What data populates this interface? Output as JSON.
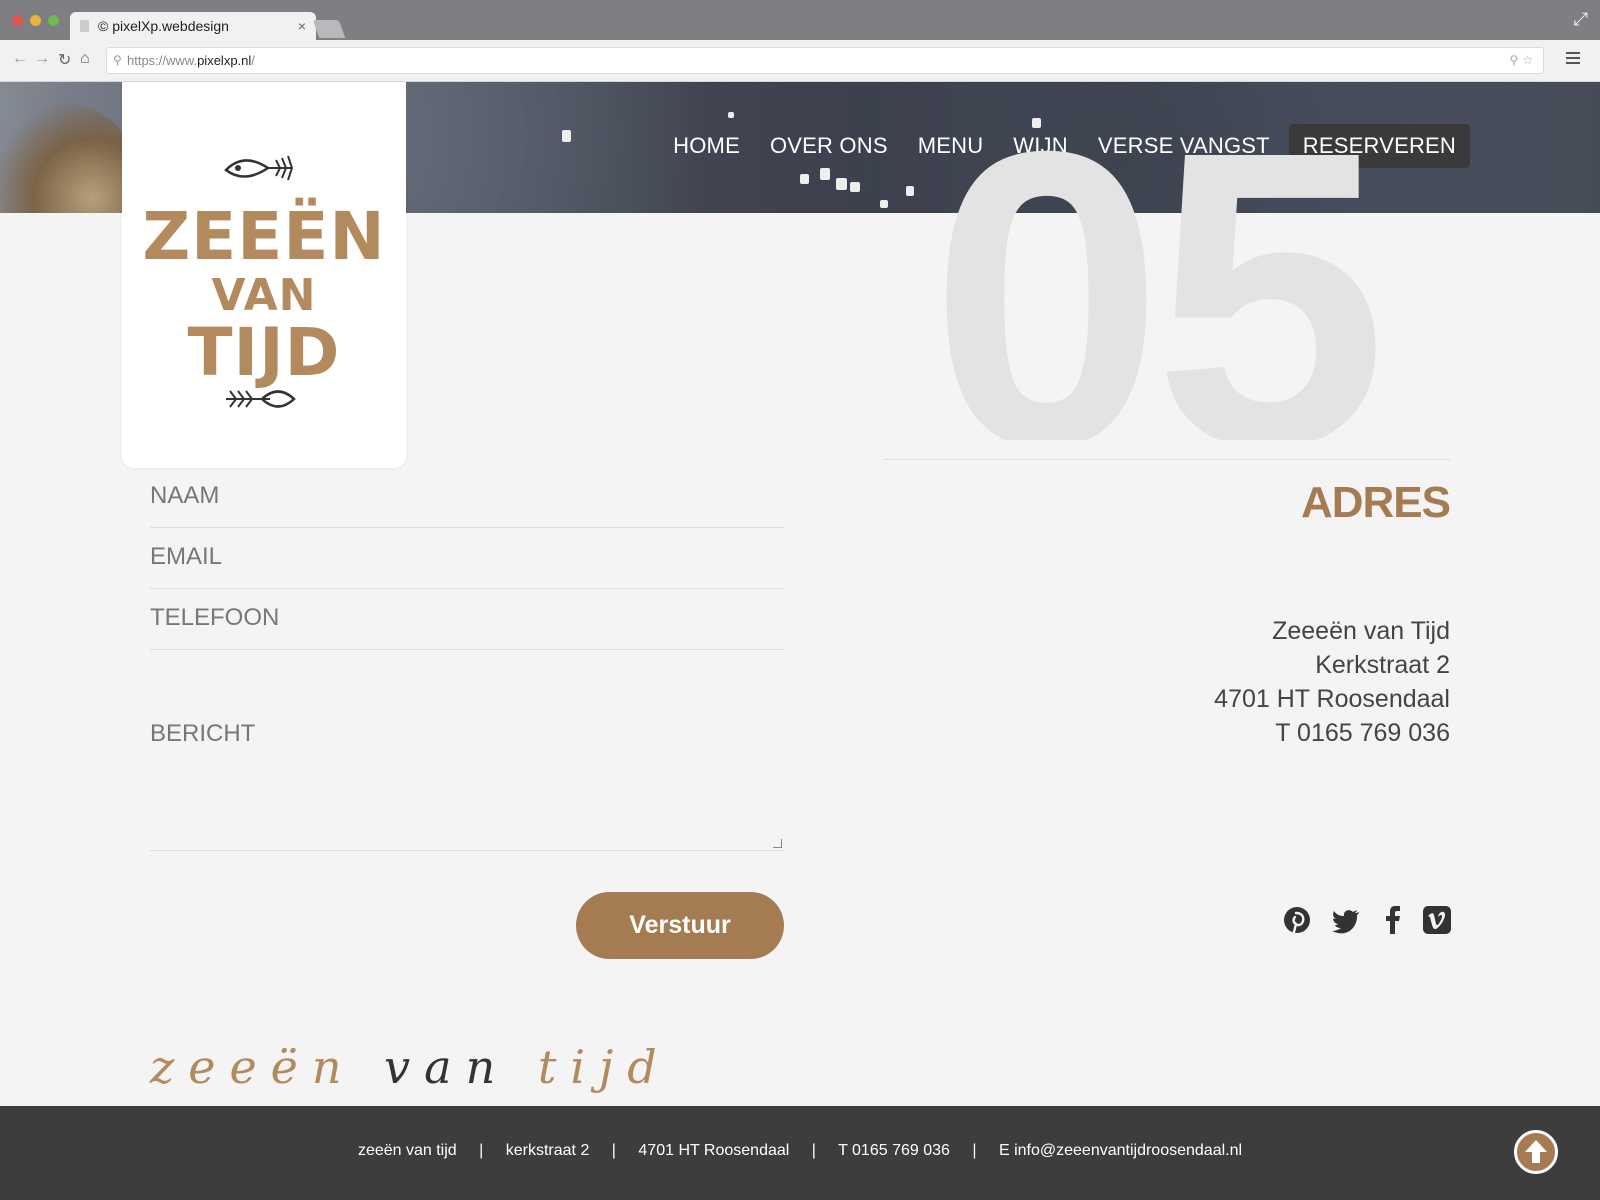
{
  "browser": {
    "tab_title": "© pixelXp.webdesign",
    "tab_close": "×",
    "url_scheme": "https://www.",
    "url_host": "pixelxp.nl",
    "url_path": "/",
    "back": "←",
    "forward": "→",
    "reload": "↻",
    "home": "⌂",
    "expand": "⤢"
  },
  "nav": {
    "items": [
      "HOME",
      "OVER ONS",
      "MENU",
      "WIJN",
      "VERSE VANGST"
    ],
    "cta": "RESERVEREN"
  },
  "logo": {
    "line1": "ZEEËN",
    "line2": "VAN",
    "line3": "TIJD",
    "brand_color": "#b28a5e"
  },
  "section": {
    "number": "05",
    "title": "ADRES"
  },
  "form": {
    "name_placeholder": "NAAM",
    "email_placeholder": "EMAIL",
    "phone_placeholder": "TELEFOON",
    "message_placeholder": "BERICHT",
    "submit_label": "Verstuur"
  },
  "address": {
    "name": "Zeeeën van Tijd",
    "street": "Kerkstraat 2",
    "city": "4701 HT Roosendaal",
    "phone": "T 0165 769 036"
  },
  "social": [
    "pinterest-icon",
    "twitter-icon",
    "facebook-icon",
    "vimeo-icon"
  ],
  "signature": {
    "part1": "zeeën",
    "part2": "van",
    "part3": "tijd"
  },
  "footer": {
    "items": [
      "zeeën van tijd",
      "kerkstraat 2",
      "4701 HT Roosendaal",
      "T 0165 769 036",
      "E info@zeeenvantijdroosendaal.nl"
    ],
    "separator": "|"
  },
  "colors": {
    "accent": "#a57c52",
    "footer_bg": "#3d3d3d",
    "cta_bg": "#3a3a3a"
  }
}
